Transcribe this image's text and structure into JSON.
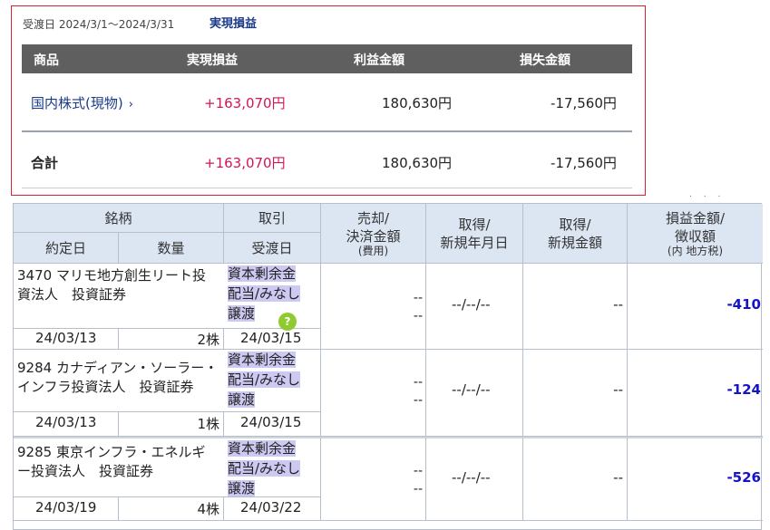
{
  "summary": {
    "period_label": "受渡日 2024/3/1〜2024/3/31",
    "title": "実現損益",
    "headers": [
      "商品",
      "実現損益",
      "利益金額",
      "損失金額"
    ],
    "rows": [
      {
        "product": "国内株式(現物)",
        "realized": "+163,070円",
        "profit": "180,630円",
        "loss": "-17,560円"
      }
    ],
    "total": {
      "label": "合計",
      "realized": "+163,070円",
      "profit": "180,630円",
      "loss": "-17,560円"
    },
    "colors": {
      "border": "#d9232e",
      "header_bg": "#5f5f5f",
      "link": "#1a3a8a",
      "profit": "#d4145a"
    }
  },
  "detail": {
    "headers": {
      "meigara": "銘柄",
      "torihiki": "取引",
      "baikyaku_1": "売却/",
      "baikyaku_2": "決済金額",
      "baikyaku_sub": "(費用)",
      "shutoku_date_1": "取得/",
      "shutoku_date_2": "新規年月日",
      "shutoku_amt_1": "取得/",
      "shutoku_amt_2": "新規金額",
      "pl_1": "損益金額/",
      "pl_2": "徴収額",
      "pl_sub": "(内 地方税)",
      "yakujo": "約定日",
      "suryo": "数量",
      "ukewatashi": "受渡日"
    },
    "rows": [
      {
        "name_1": "3470 マリモ地方創生リート投",
        "name_2": "資法人　投資証券",
        "type_1": "資本剰余金",
        "type_2": "配当/みなし",
        "type_3": "譲渡",
        "dash_1": "--",
        "dash_2": "--",
        "acq_date": "--/--/--",
        "acq_amt": "--",
        "pl": "-410",
        "trade_date": "24/03/13",
        "qty": "2株",
        "settle_date": "24/03/15"
      },
      {
        "name_1": "9284 カナディアン・ソーラー・",
        "name_2": "インフラ投資法人　投資証券",
        "type_1": "資本剰余金",
        "type_2": "配当/みなし",
        "type_3": "譲渡",
        "dash_1": "--",
        "dash_2": "--",
        "acq_date": "--/--/--",
        "acq_amt": "--",
        "pl": "-124",
        "trade_date": "24/03/13",
        "qty": "1株",
        "settle_date": "24/03/15"
      },
      {
        "name_1": "9285 東京インフラ・エネルギ",
        "name_2": "ー投資法人　投資証券",
        "type_1": "資本剰余金",
        "type_2": "配当/みなし",
        "type_3": "譲渡",
        "dash_1": "--",
        "dash_2": "--",
        "acq_date": "--/--/--",
        "acq_amt": "--",
        "pl": "-526",
        "trade_date": "24/03/19",
        "qty": "4株",
        "settle_date": "24/03/22"
      }
    ],
    "help_badge": "?",
    "colors": {
      "header_bg": "#dce6f2",
      "loss": "#1414c8",
      "highlight": "#ccc9f2",
      "help": "#8ecb2e"
    }
  }
}
